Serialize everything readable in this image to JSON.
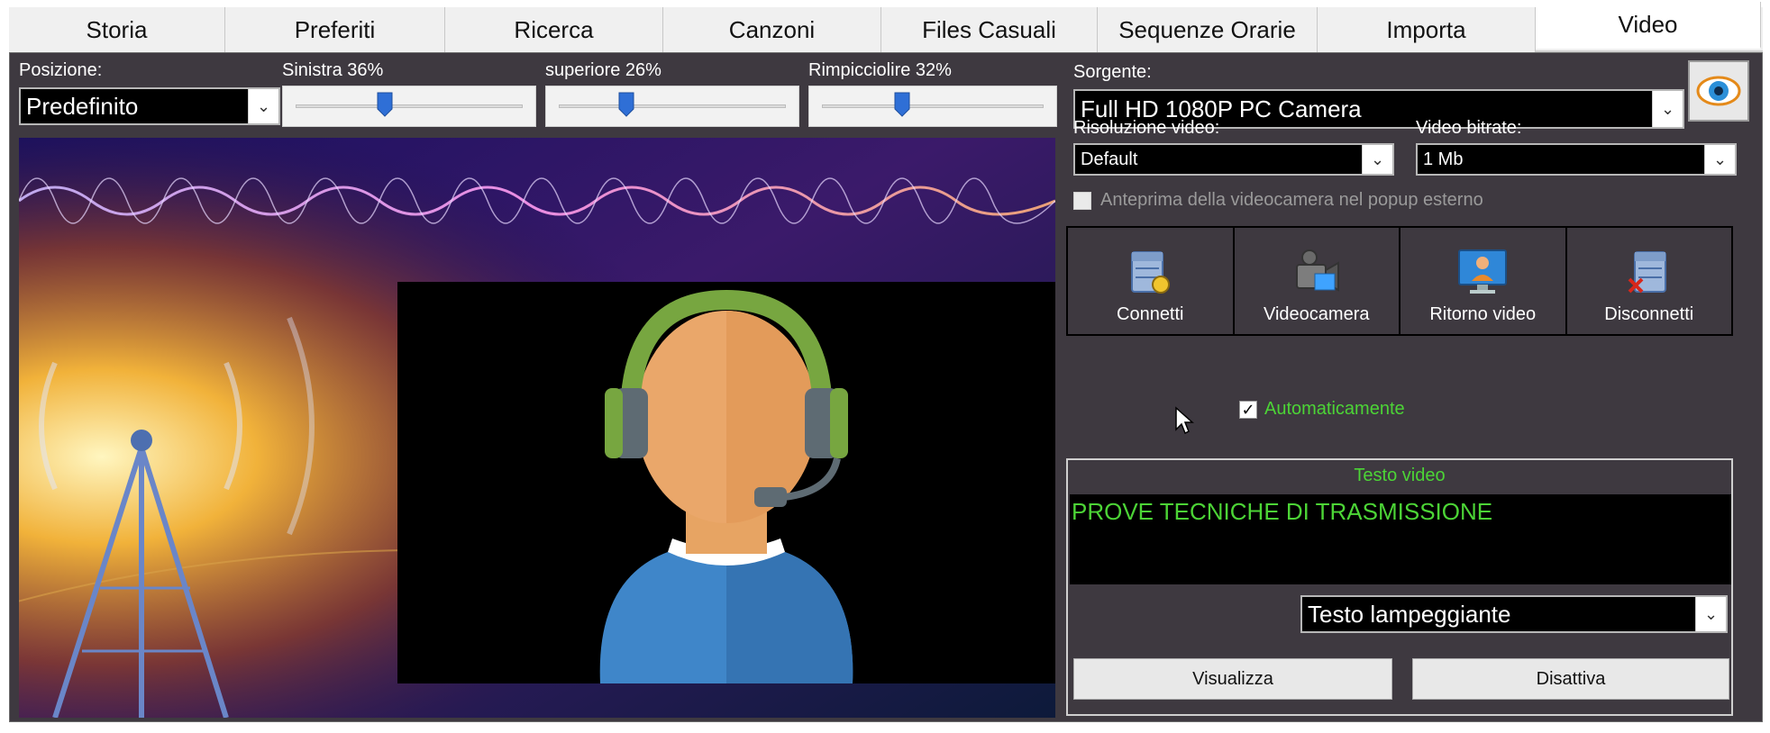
{
  "tabs": [
    {
      "label": "Storia"
    },
    {
      "label": "Preferiti"
    },
    {
      "label": "Ricerca"
    },
    {
      "label": "Canzoni"
    },
    {
      "label": "Files Casuali"
    },
    {
      "label": "Sequenze Orarie"
    },
    {
      "label": "Importa"
    },
    {
      "label": "Video"
    }
  ],
  "active_tab": "Video",
  "position": {
    "label": "Posizione:",
    "value": "Predefinito"
  },
  "sliders": {
    "left": {
      "label": "Sinistra 36%",
      "value_pct": 36
    },
    "top": {
      "label": "superiore 26%",
      "value_pct": 26
    },
    "shrink": {
      "label": "Rimpicciolire 32%",
      "value_pct": 32
    }
  },
  "source": {
    "label": "Sorgente:",
    "value": "Full HD 1080P PC Camera"
  },
  "resolution": {
    "label": "Risoluzione video:",
    "value": "Default"
  },
  "bitrate": {
    "label": "Video bitrate:",
    "value": "1 Mb"
  },
  "preview_popup": {
    "label": "Anteprima della videocamera nel popup esterno",
    "checked": false
  },
  "actions": {
    "connect": "Connetti",
    "camera": "Videocamera",
    "return_video": "Ritorno video",
    "disconnect": "Disconnetti"
  },
  "auto": {
    "label": "Automaticamente",
    "checked": true
  },
  "text_video": {
    "title": "Testo video",
    "content": "PROVE TECNICHE DI TRASMISSIONE",
    "mode": "Testo lampeggiante",
    "show_button": "Visualizza",
    "disable_button": "Disattiva"
  },
  "colors": {
    "panel_bg": "#3e3940",
    "accent_green": "#4cd436",
    "slider_thumb": "#2f6fd6"
  }
}
